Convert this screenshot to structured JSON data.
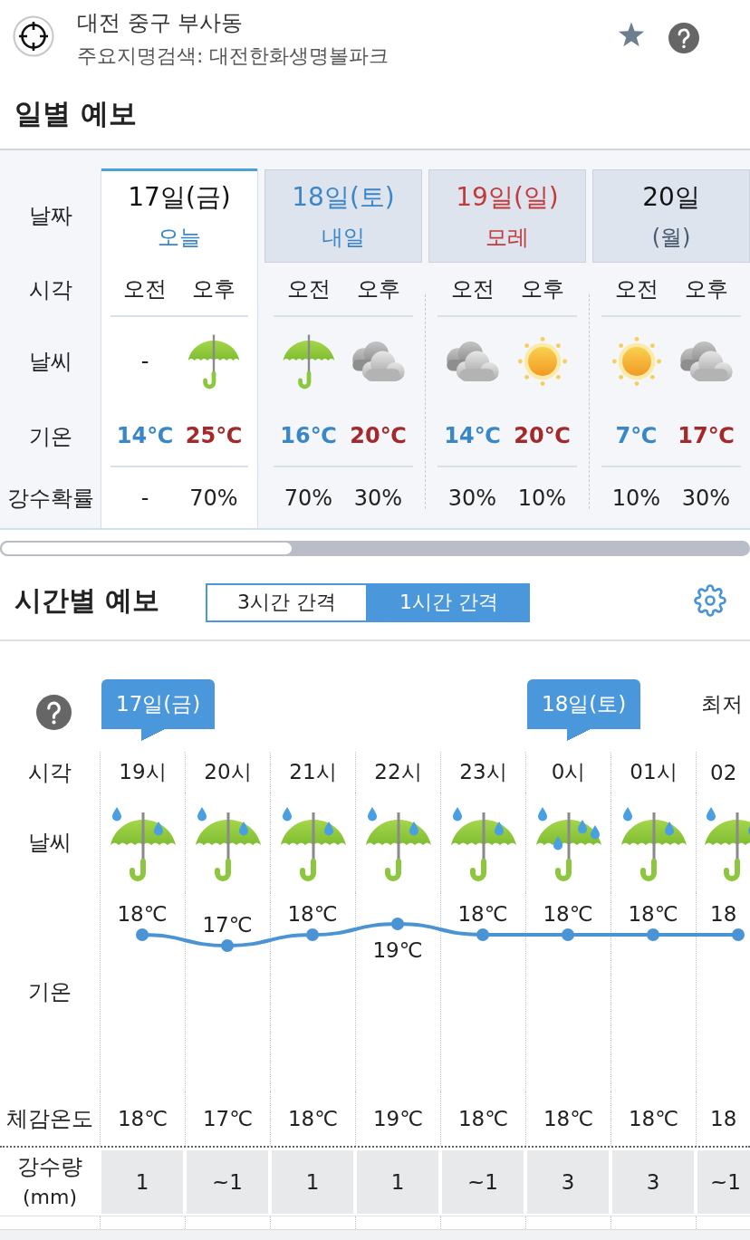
{
  "header": {
    "location": "대전 중구 부사동",
    "subtitle": "주요지명검색: 대전한화생명볼파크"
  },
  "daily": {
    "title": "일별 예보",
    "row_labels": [
      "날짜",
      "시각",
      "날씨",
      "기온",
      "강수확률"
    ],
    "days": [
      {
        "date": "17일(금)",
        "sub": "오늘",
        "kind": "weekday",
        "selected": true,
        "periods": [
          {
            "label": "오전",
            "kind": "text",
            "weather_text": "-",
            "temp": "14℃",
            "precip": "-"
          },
          {
            "label": "오후",
            "kind": "rain",
            "temp": "25℃",
            "precip": "70%"
          }
        ]
      },
      {
        "date": "18일(토)",
        "sub": "내일",
        "kind": "saturday",
        "selected": false,
        "periods": [
          {
            "label": "오전",
            "kind": "rain",
            "temp": "16℃",
            "precip": "70%"
          },
          {
            "label": "오후",
            "kind": "cloudy",
            "temp": "20℃",
            "precip": "30%"
          }
        ]
      },
      {
        "date": "19일(일)",
        "sub": "모레",
        "kind": "sunday",
        "selected": false,
        "periods": [
          {
            "label": "오전",
            "kind": "cloudy",
            "temp": "14℃",
            "precip": "30%"
          },
          {
            "label": "오후",
            "kind": "sunny",
            "temp": "20℃",
            "precip": "10%"
          }
        ]
      },
      {
        "date": "20일",
        "sub": "(월)",
        "kind": "weekday",
        "selected": false,
        "periods": [
          {
            "label": "오전",
            "kind": "sunny",
            "temp": "7℃",
            "precip": "10%"
          },
          {
            "label": "오후",
            "kind": "cloudy",
            "temp": "17℃",
            "precip": "30%"
          }
        ]
      }
    ]
  },
  "hourly": {
    "title": "시간별 예보",
    "intervals": [
      {
        "label": "3시간 간격",
        "selected": false
      },
      {
        "label": "1시간 간격",
        "selected": true
      }
    ],
    "row_labels": {
      "time": "시각",
      "weather": "날씨",
      "feels": "체감온도",
      "precip": "강수량",
      "precip_unit": "(mm)"
    },
    "legend": "최저",
    "hours": [
      {
        "time": "19시",
        "date_marker": "17일(금)",
        "kind": "rain",
        "temp_unit": "℃",
        "feels": "18℃",
        "precip": "1"
      },
      {
        "time": "20시",
        "kind": "rain",
        "temp_unit": "℃",
        "feels": "17℃",
        "precip": "~1"
      },
      {
        "time": "21시",
        "kind": "rain",
        "temp_unit": "℃",
        "feels": "18℃",
        "precip": "1"
      },
      {
        "time": "22시",
        "kind": "rain",
        "temp_unit": "℃",
        "feels": "19℃",
        "precip": "1"
      },
      {
        "time": "23시",
        "kind": "rain",
        "temp_unit": "℃",
        "feels": "18℃",
        "precip": "~1"
      },
      {
        "time": "0시",
        "date_marker": "18일(토)",
        "kind": "heavy_rain",
        "temp_unit": "℃",
        "feels": "18℃",
        "precip": "3"
      },
      {
        "time": "01시",
        "kind": "rain",
        "temp_unit": "℃",
        "feels": "18℃",
        "precip": "3"
      },
      {
        "time": "02",
        "kind": "rain",
        "feels": "18",
        "precip": "~1"
      }
    ],
    "chart_data": {
      "type": "line",
      "series": [
        {
          "name": "기온",
          "color": "#4a94d6",
          "marker": true,
          "values": [
            18,
            17,
            18,
            19,
            18,
            18,
            18,
            18
          ]
        }
      ],
      "data_labels": true,
      "value_labels": [
        "18",
        "17",
        "18",
        "19",
        "18",
        "18",
        "18",
        "18"
      ]
    }
  }
}
